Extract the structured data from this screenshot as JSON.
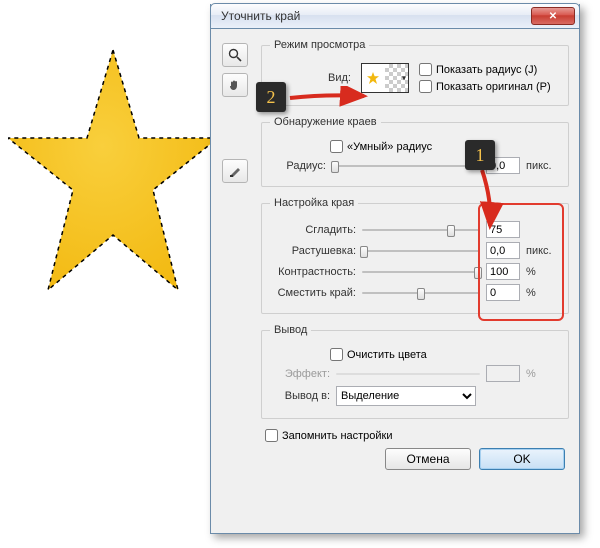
{
  "window": {
    "title": "Уточнить край"
  },
  "groups": {
    "view": "Режим просмотра",
    "edge": "Обнаружение краев",
    "adjust": "Настройка края",
    "output": "Вывод"
  },
  "view": {
    "label": "Вид:",
    "show_radius": "Показать радиус (J)",
    "show_original": "Показать оригинал (P)"
  },
  "edge": {
    "smart": "«Умный» радиус",
    "radius_label": "Радиус:",
    "radius_value": "0,0",
    "radius_unit": "пикс."
  },
  "adjust": {
    "smooth_label": "Сгладить:",
    "smooth_value": "75",
    "feather_label": "Растушевка:",
    "feather_value": "0,0",
    "feather_unit": "пикс.",
    "contrast_label": "Контрастность:",
    "contrast_value": "100",
    "contrast_unit": "%",
    "shift_label": "Сместить край:",
    "shift_value": "0",
    "shift_unit": "%"
  },
  "output": {
    "decontaminate": "Очистить цвета",
    "amount_label": "Эффект:",
    "amount_unit": "%",
    "outputto_label": "Вывод в:",
    "outputto_value": "Выделение"
  },
  "remember": "Запомнить настройки",
  "buttons": {
    "cancel": "Отмена",
    "ok": "OK"
  },
  "callouts": {
    "one": "1",
    "two": "2"
  }
}
